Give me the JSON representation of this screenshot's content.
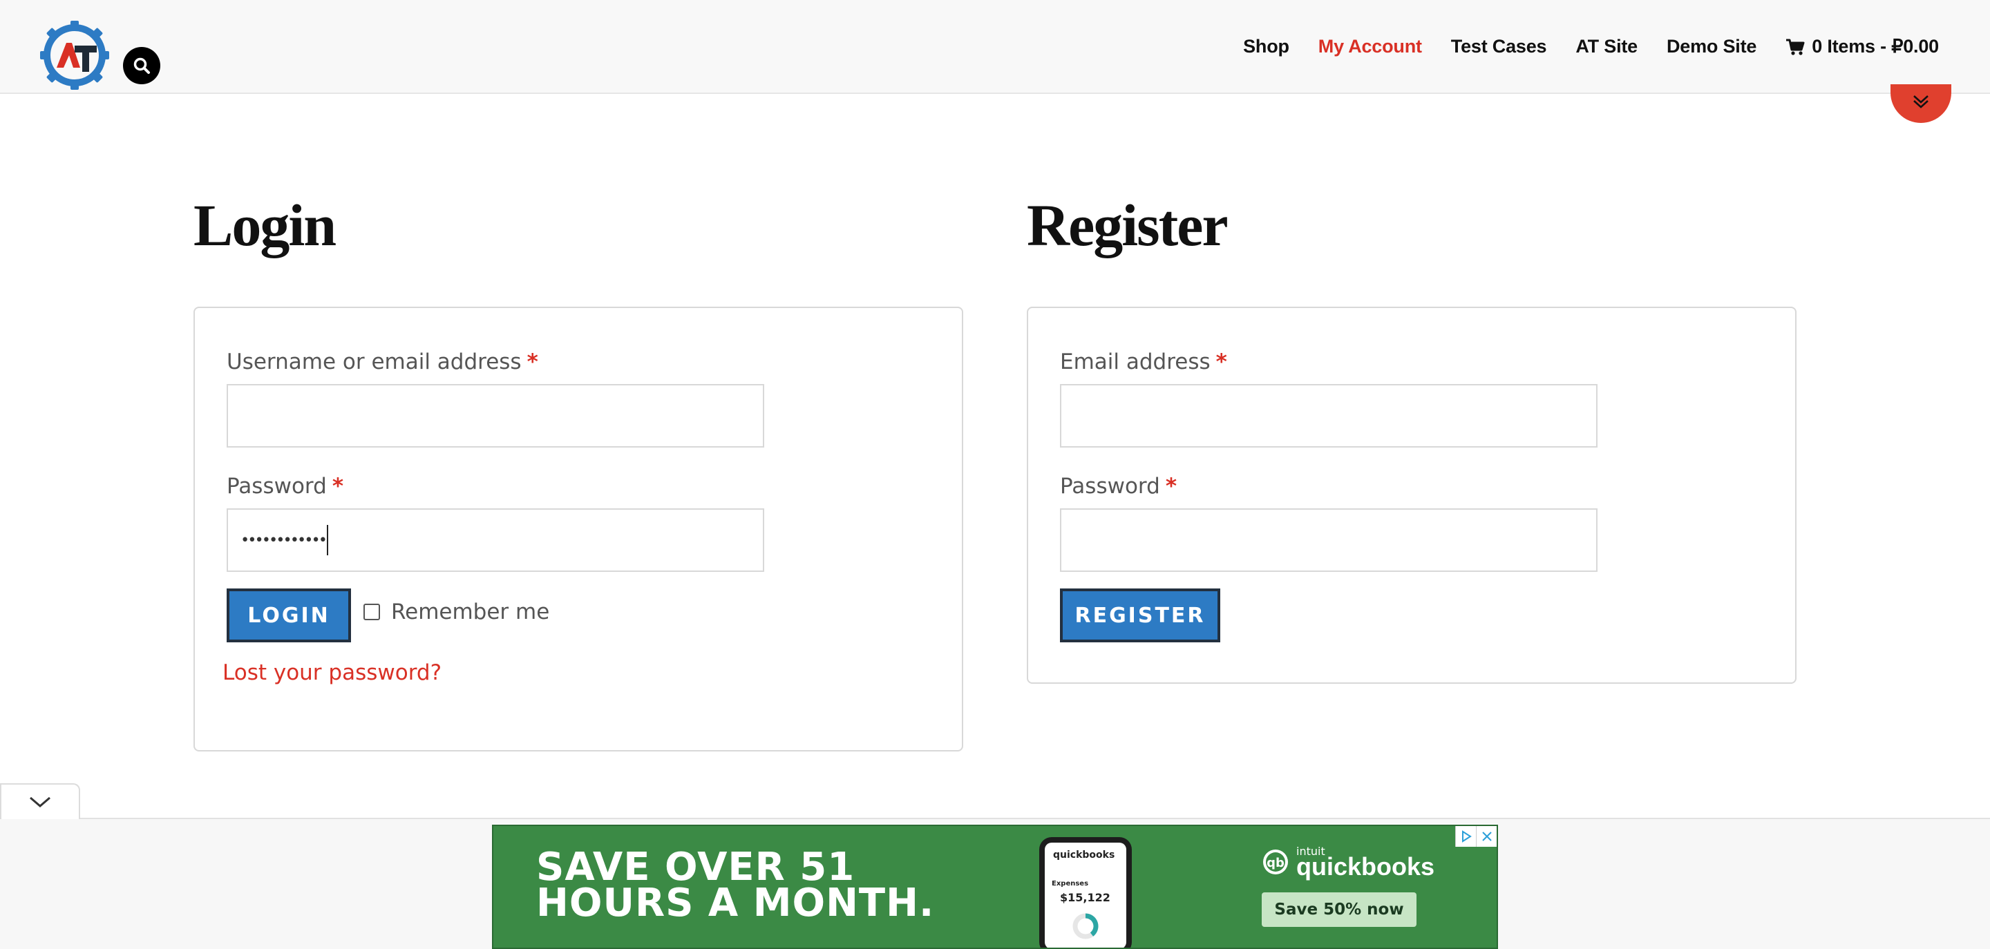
{
  "header": {
    "nav": [
      {
        "label": "Shop",
        "active": false
      },
      {
        "label": "My Account",
        "active": true
      },
      {
        "label": "Test Cases",
        "active": false
      },
      {
        "label": "AT Site",
        "active": false
      },
      {
        "label": "Demo Site",
        "active": false
      }
    ],
    "cart_label": "0 Items - ₽0.00",
    "icons": {
      "logo": "logo-at-gear",
      "search": "search-icon",
      "cart": "cart-icon",
      "scroll": "chevron-double-down-icon"
    }
  },
  "login": {
    "title": "Login",
    "username_label": "Username or email address",
    "password_label": "Password",
    "required_marker": "*",
    "username_value": "",
    "password_value": "••••••••••••",
    "button_label": "LOGIN",
    "remember_label": "Remember me",
    "remember_checked": false,
    "lost_password_link": "Lost your password?"
  },
  "register": {
    "title": "Register",
    "email_label": "Email address",
    "password_label": "Password",
    "required_marker": "*",
    "email_value": "",
    "password_value": "",
    "button_label": "REGISTER"
  },
  "ad": {
    "headline_line1": "SAVE OVER 51",
    "headline_line2": "HOURS A MONTH.",
    "brand_small": "intuit",
    "brand_name": "quickbooks",
    "cta": "Save 50% now",
    "phone_brand": "quickbooks",
    "phone_label": "Expenses",
    "phone_amount": "$15,122"
  },
  "colors": {
    "accent_red": "#d93025",
    "button_blue": "#2d7bc4",
    "ad_green": "#3b8a45"
  }
}
